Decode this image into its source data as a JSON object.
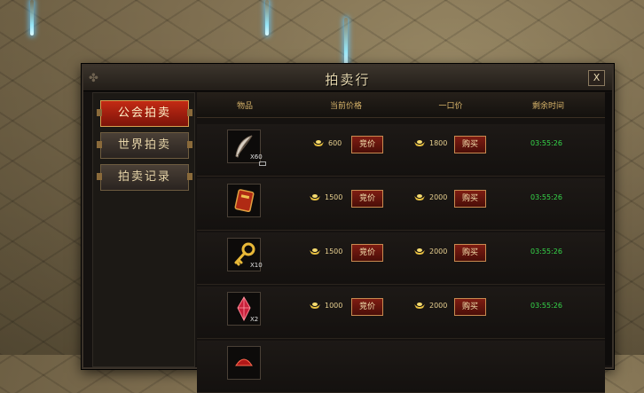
{
  "window": {
    "title": "拍卖行",
    "close_label": "X"
  },
  "tabs": [
    {
      "label": "公会拍卖",
      "active": true
    },
    {
      "label": "世界拍卖",
      "active": false
    },
    {
      "label": "拍卖记录",
      "active": false
    }
  ],
  "table": {
    "headers": [
      "物品",
      "当前价格",
      "一口价",
      "剩余时间"
    ],
    "rows": [
      {
        "item_icon": "feather-icon",
        "qty": "X60",
        "current_price": "600",
        "bid_label": "竞价",
        "buyout_price": "1800",
        "buy_label": "购买",
        "time_left": "03:55:26"
      },
      {
        "item_icon": "red-book-icon",
        "qty": "",
        "current_price": "1500",
        "bid_label": "竞价",
        "buyout_price": "2000",
        "buy_label": "购买",
        "time_left": "03:55:26"
      },
      {
        "item_icon": "golden-key-icon",
        "qty": "X10",
        "current_price": "1500",
        "bid_label": "竞价",
        "buyout_price": "2000",
        "buy_label": "购买",
        "time_left": "03:55:26"
      },
      {
        "item_icon": "red-crystal-icon",
        "qty": "X2",
        "current_price": "1000",
        "bid_label": "竞价",
        "buyout_price": "2000",
        "buy_label": "购买",
        "time_left": "03:55:26"
      },
      {
        "item_icon": "red-item-icon",
        "qty": "",
        "current_price": "",
        "bid_label": "",
        "buyout_price": "",
        "buy_label": "",
        "time_left": ""
      }
    ]
  },
  "colors": {
    "accent_red": "#c32a14",
    "gold_text": "#d8b46a",
    "timer_green": "#36d84a"
  }
}
